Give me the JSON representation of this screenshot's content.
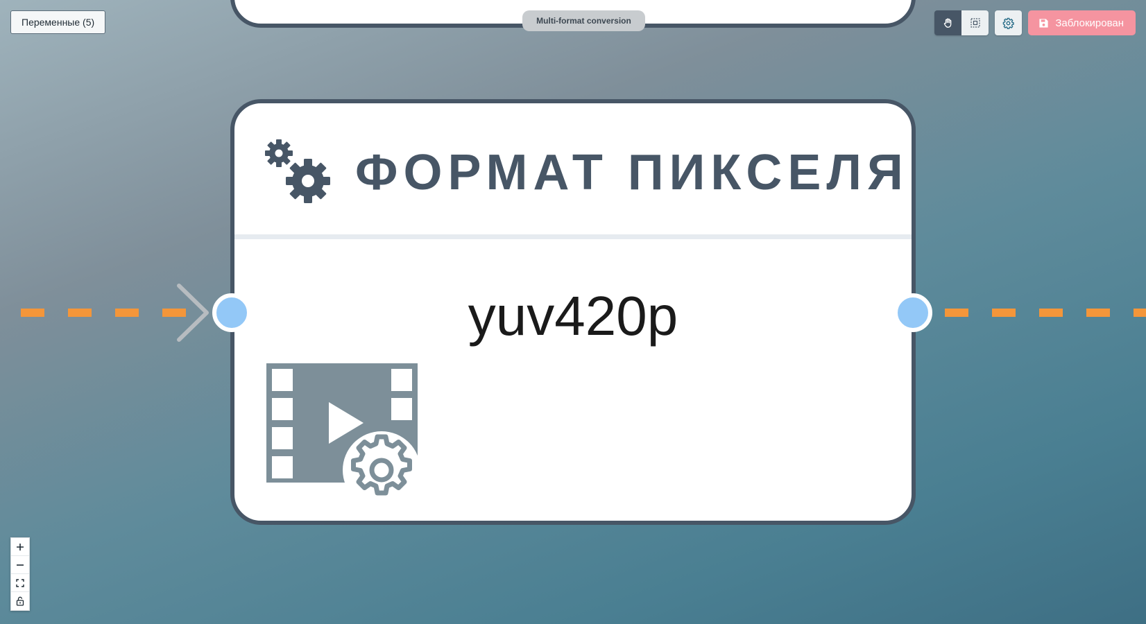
{
  "toolbar_left": {
    "variables_label": "Переменные (5)"
  },
  "flow": {
    "label": "Multi-format conversion"
  },
  "toolbar_right": {
    "pan_icon": "hand-icon",
    "select_icon": "selection-icon",
    "settings_icon": "gear-icon",
    "locked_label": "Заблокирован",
    "locked_icon": "save-icon"
  },
  "node": {
    "title": "ФОРМАТ ПИКСЕЛЯ",
    "value": "yuv420p",
    "header_icon": "gears-icon",
    "body_icon": "video-settings-icon"
  },
  "zoom_controls": {
    "zoom_in_icon": "plus-icon",
    "zoom_out_icon": "minus-icon",
    "fit_view_icon": "fit-view-icon",
    "lock_icon": "unlock-icon"
  },
  "colors": {
    "node_border": "#475666",
    "edge": "#f4963a",
    "handle": "#93c8f7",
    "locked_button": "#f594a0"
  }
}
